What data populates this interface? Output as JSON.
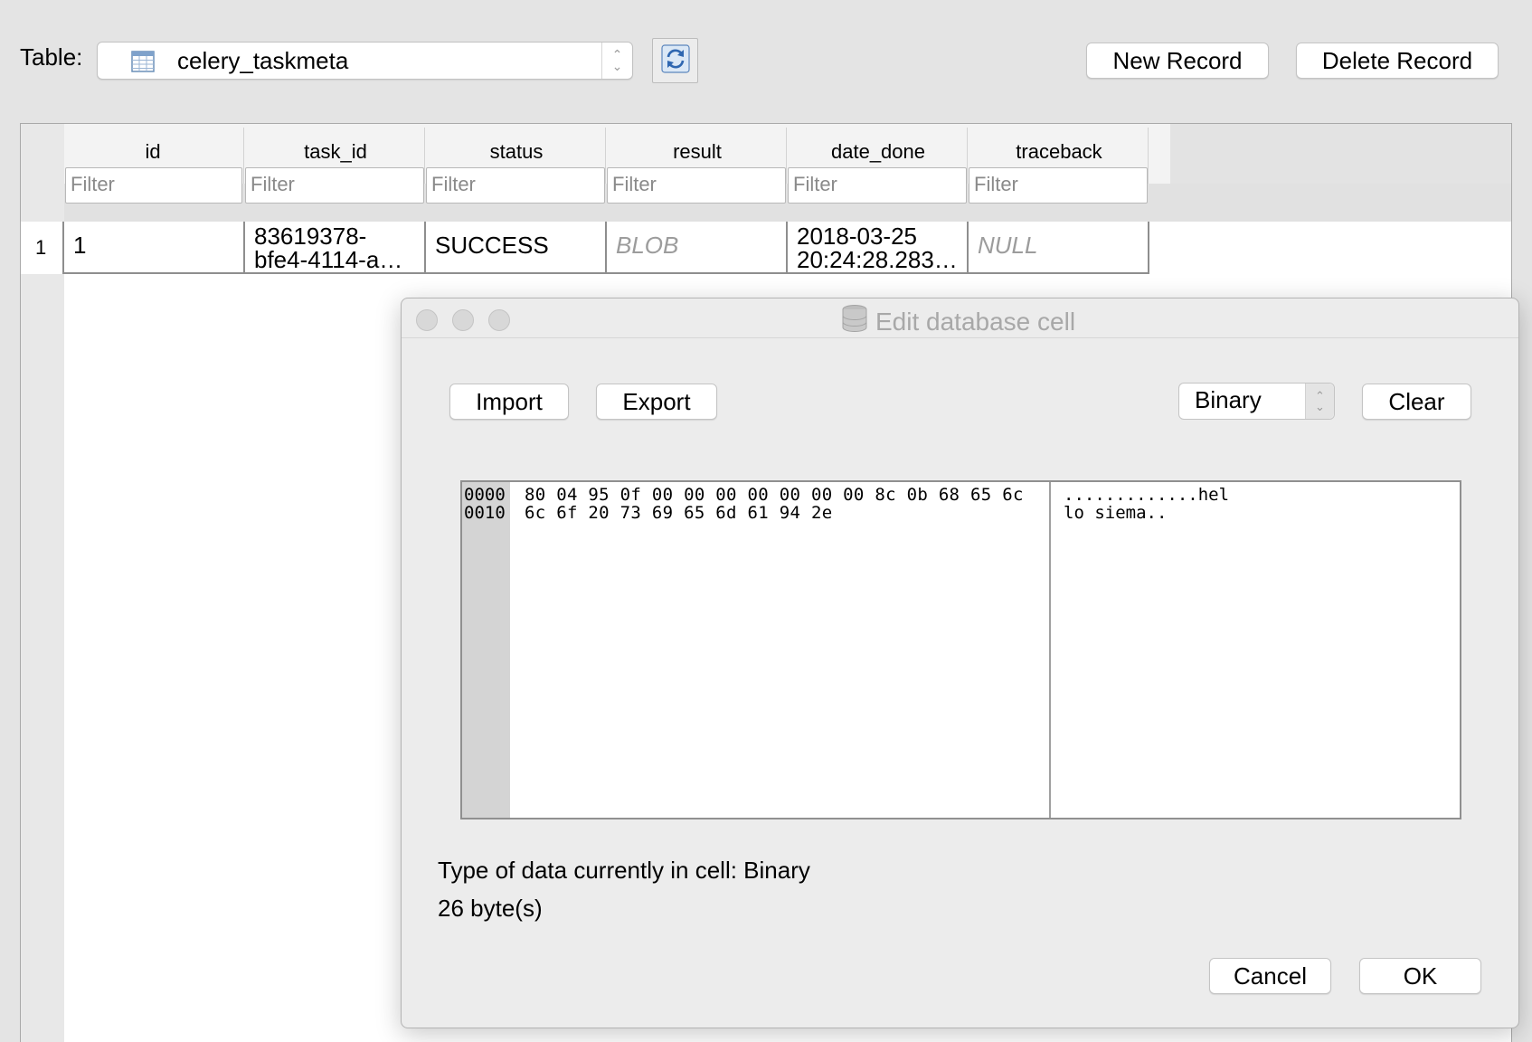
{
  "toolbar": {
    "table_label": "Table:",
    "table_select_value": "celery_taskmeta",
    "new_record": "New Record",
    "delete_record": "Delete Record"
  },
  "grid": {
    "columns": [
      "id",
      "task_id",
      "status",
      "result",
      "date_done",
      "traceback"
    ],
    "filter_placeholder": "Filter",
    "rows": [
      {
        "row_number": "1",
        "id": "1",
        "task_id": "83619378-\nbfe4-4114-a…",
        "status": "SUCCESS",
        "result": "BLOB",
        "date_done": "2018-03-25\n20:24:28.283…",
        "traceback": "NULL"
      }
    ]
  },
  "dialog": {
    "title": "Edit database cell",
    "import": "Import",
    "export": "Export",
    "mode_select_value": "Binary",
    "clear": "Clear",
    "hex": {
      "offsets": [
        "0000",
        "0010"
      ],
      "bytes": [
        "80 04 95 0f 00 00 00 00 00 00 00 8c 0b 68 65 6c",
        "6c 6f 20 73 69 65 6d 61 94 2e"
      ],
      "ascii": [
        ".............hel",
        "lo siema.."
      ]
    },
    "type_info": "Type of data currently in cell: Binary",
    "size_info": "26 byte(s)",
    "cancel": "Cancel",
    "ok": "OK"
  },
  "colors": {
    "window_bg": "#e4e4e4",
    "muted_text": "#9c9c9c",
    "hex_offset_bg": "#d4d4d4"
  }
}
